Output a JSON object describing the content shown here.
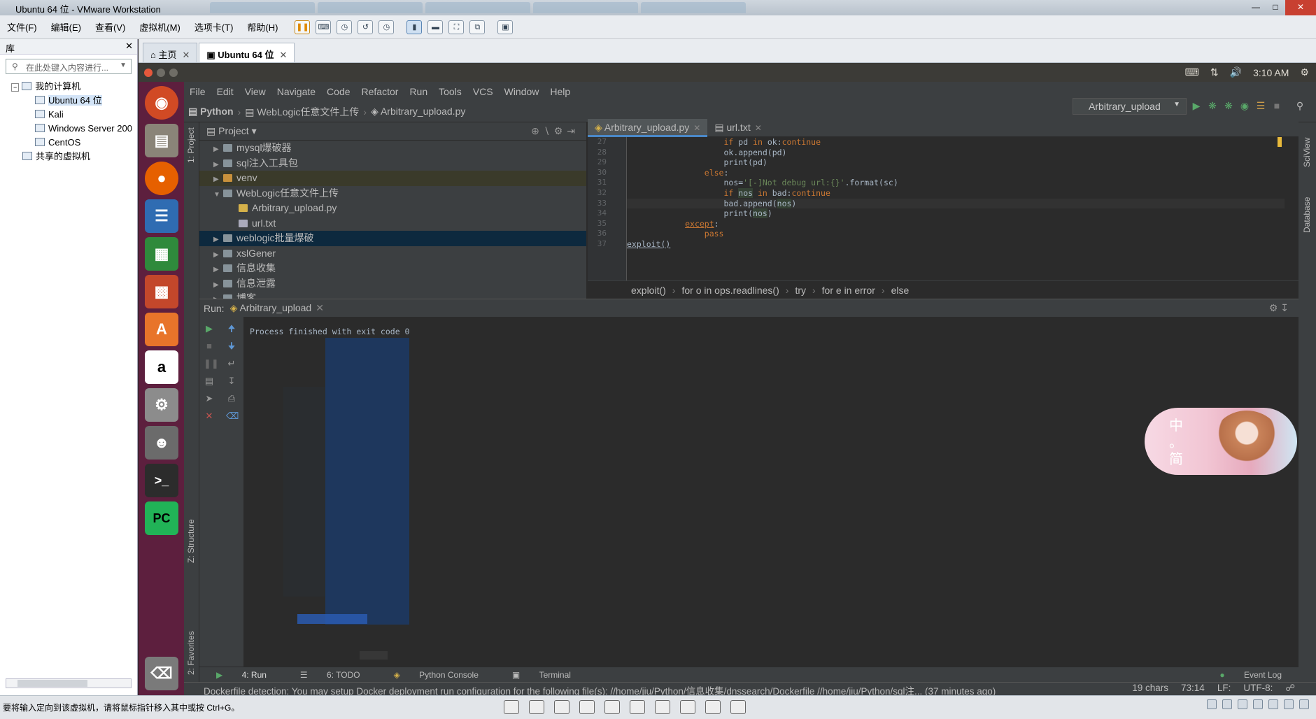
{
  "vm": {
    "title": "Ubuntu 64 位 - VMware Workstation",
    "menu": [
      "文件(F)",
      "编辑(E)",
      "查看(V)",
      "虚拟机(M)",
      "选项卡(T)",
      "帮助(H)"
    ],
    "library": {
      "title": "库",
      "search_placeholder": "在此处键入内容进行...",
      "tree": [
        {
          "label": "我的计算机",
          "level": 0
        },
        {
          "label": "Ubuntu 64 位",
          "level": 1,
          "selected": true
        },
        {
          "label": "Kali",
          "level": 1
        },
        {
          "label": "Windows Server 200",
          "level": 1
        },
        {
          "label": "CentOS",
          "level": 1
        },
        {
          "label": "共享的虚拟机",
          "level": 0
        }
      ]
    },
    "tabs": [
      {
        "label": "主页"
      },
      {
        "label": "Ubuntu 64 位"
      }
    ],
    "status_text": "要将输入定向到该虚拟机，请将鼠标指针移入其中或按 Ctrl+G。"
  },
  "ubuntu": {
    "clock": "3:10 AM"
  },
  "pycharm": {
    "menu": [
      "File",
      "Edit",
      "View",
      "Navigate",
      "Code",
      "Refactor",
      "Run",
      "Tools",
      "VCS",
      "Window",
      "Help"
    ],
    "nav": [
      "Python",
      "WebLogic任意文件上传",
      "Arbitrary_upload.py"
    ],
    "run_config": "Arbitrary_upload",
    "project_panel": {
      "title": "Project",
      "items": [
        {
          "label": "mysql爆破器",
          "type": "folder"
        },
        {
          "label": "sql注入工具包",
          "type": "folder"
        },
        {
          "label": "venv",
          "type": "folder"
        },
        {
          "label": "WebLogic任意文件上传",
          "type": "folder",
          "open": true
        },
        {
          "label": "Arbitrary_upload.py",
          "type": "file"
        },
        {
          "label": "url.txt",
          "type": "file"
        },
        {
          "label": "weblogic批量爆破",
          "type": "folder"
        },
        {
          "label": "xslGener",
          "type": "folder"
        },
        {
          "label": "信息收集",
          "type": "folder"
        },
        {
          "label": "信息泄露",
          "type": "folder"
        },
        {
          "label": "博客",
          "type": "folder"
        }
      ]
    },
    "side_left": {
      "project": "1: Project",
      "structure": "Z: Structure",
      "favorites": "2: Favorites"
    },
    "side_right": {
      "sciview": "SciView",
      "database": "Database"
    },
    "editor": {
      "tabs": [
        "Arbitrary_upload.py",
        "url.txt"
      ],
      "line_numbers": [
        "27",
        "28",
        "29",
        "30",
        "31",
        "32",
        "33",
        "34",
        "35",
        "36",
        "37"
      ],
      "breadcrumbs": [
        "exploit()",
        "for o in ops.readlines()",
        "try",
        "for e in error",
        "else"
      ]
    },
    "run": {
      "label": "Run:",
      "tab": "Arbitrary_upload",
      "finished": "Process finished with exit code 0"
    },
    "bottom_tabs": [
      "4: Run",
      "6: TODO",
      "Python Console",
      "Terminal",
      "Event Log"
    ],
    "status": {
      "message": "Dockerfile detection: You may setup Docker deployment run configuration for the following file(s): //home/jiu/Python/信息收集/dnssearch/Dockerfile //home/jiu/Python/sql注... (37 minutes ago)",
      "chars": "19 chars",
      "pos": "73:14",
      "lf": "LF:",
      "enc": "UTF-8:"
    }
  },
  "sticker": {
    "text": "中 。 简"
  }
}
